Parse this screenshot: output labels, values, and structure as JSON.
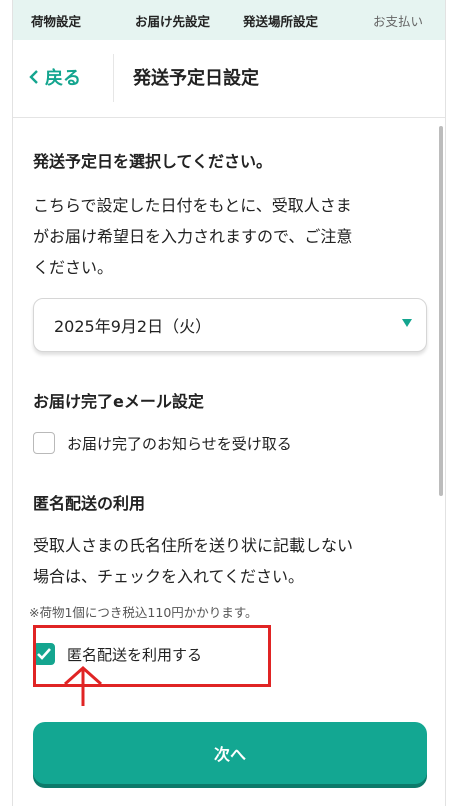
{
  "steps": [
    "荷物設定",
    "お届け先設定",
    "発送場所設定",
    "お支払い"
  ],
  "header": {
    "back_label": "戻る",
    "title": "発送予定日設定"
  },
  "ship_date": {
    "heading": "発送予定日を選択してください。",
    "description_lines": [
      "こちらで設定した日付をもとに、受取人さま",
      "がお届け希望日を入力されますので、ご注意",
      "ください。"
    ],
    "selected": "2025年9月2日（火）"
  },
  "email": {
    "heading": "お届け完了eメール設定",
    "checkbox_label": "お届け完了のお知らせを受け取る",
    "checked": false
  },
  "anonymous": {
    "heading": "匿名配送の利用",
    "description_lines": [
      "受取人さまの氏名住所を送り状に記載しない",
      "場合は、チェックを入れてください。"
    ],
    "note": "※荷物1個につき税込110円かかります。",
    "checkbox_label": "匿名配送を利用する",
    "checked": true
  },
  "next_button": "次へ",
  "colors": {
    "accent": "#14a58f",
    "highlight": "#e02424",
    "steps_bg": "#e6f4f1"
  }
}
